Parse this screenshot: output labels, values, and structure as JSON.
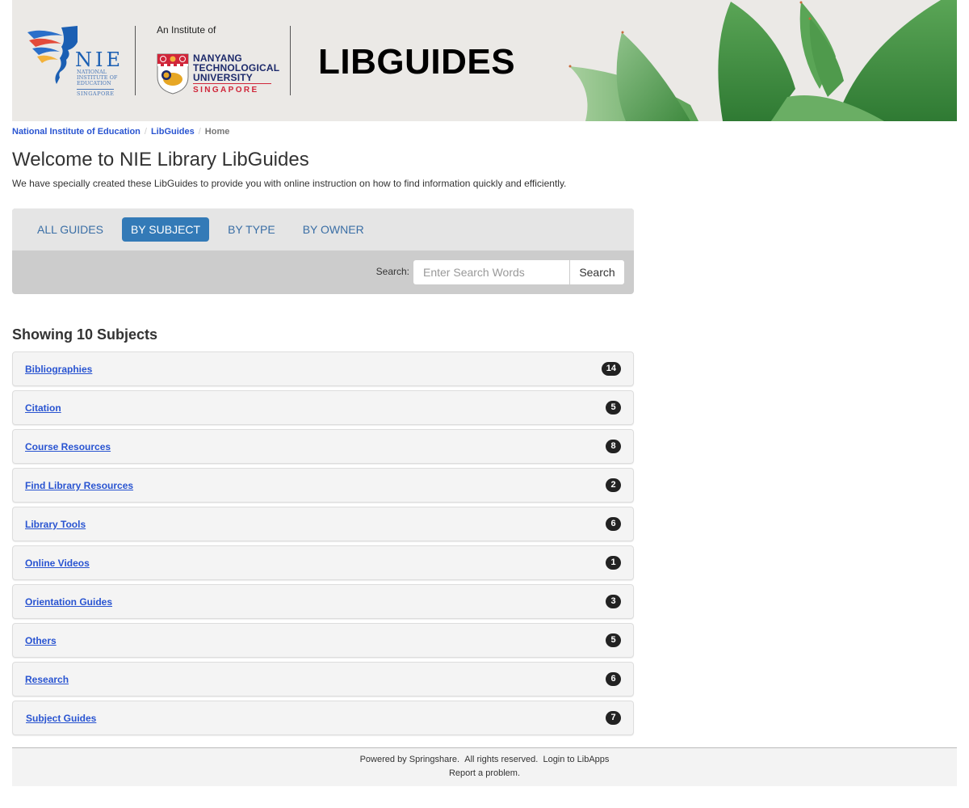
{
  "banner": {
    "nie_letters": "NIE",
    "nie_subtitle_lines": [
      "NATIONAL",
      "INSTITUTE OF",
      "EDUCATION"
    ],
    "nie_singapore": "SINGAPORE",
    "institute_of": "An Institute of",
    "ntu_lines": [
      "NANYANG",
      "TECHNOLOGICAL",
      "UNIVERSITY"
    ],
    "ntu_singapore": "SINGAPORE",
    "title": "LIBGUIDES"
  },
  "breadcrumb": {
    "items": [
      {
        "label": "National Institute of Education"
      },
      {
        "label": "LibGuides"
      },
      {
        "label": "Home"
      }
    ],
    "separator": "/"
  },
  "page": {
    "title": "Welcome to NIE Library LibGuides",
    "intro": "We have specially created these LibGuides to provide you with online instruction on how to find information quickly and efficiently."
  },
  "tabs": {
    "items": [
      {
        "label": "ALL GUIDES",
        "active": false
      },
      {
        "label": "BY SUBJECT",
        "active": true
      },
      {
        "label": "BY TYPE",
        "active": false
      },
      {
        "label": "BY OWNER",
        "active": false
      }
    ]
  },
  "search": {
    "label": "Search:",
    "placeholder": "Enter Search Words",
    "value": "",
    "button_label": "Search"
  },
  "subjects": {
    "heading": "Showing 10 Subjects",
    "items": [
      {
        "name": "Bibliographies",
        "count": "14"
      },
      {
        "name": "Citation",
        "count": "5"
      },
      {
        "name": "Course Resources",
        "count": "8"
      },
      {
        "name": "Find Library Resources",
        "count": "2"
      },
      {
        "name": "Library Tools",
        "count": "6"
      },
      {
        "name": "Online Videos",
        "count": "1"
      },
      {
        "name": "Orientation Guides",
        "count": "3"
      },
      {
        "name": "Others",
        "count": "5"
      },
      {
        "name": "Research",
        "count": "6"
      },
      {
        "name": "Subject Guides",
        "count": "7"
      }
    ]
  },
  "footer": {
    "powered_by": "Powered by Springshare.",
    "rights": "All rights reserved.",
    "login": "Login to LibApps",
    "report": "Report a problem."
  },
  "colors": {
    "link": "#2954d1",
    "active_tab": "#337ab7",
    "badge": "#222222",
    "tab_bar": "#e5e5e5",
    "search_bar": "#cccccc"
  }
}
